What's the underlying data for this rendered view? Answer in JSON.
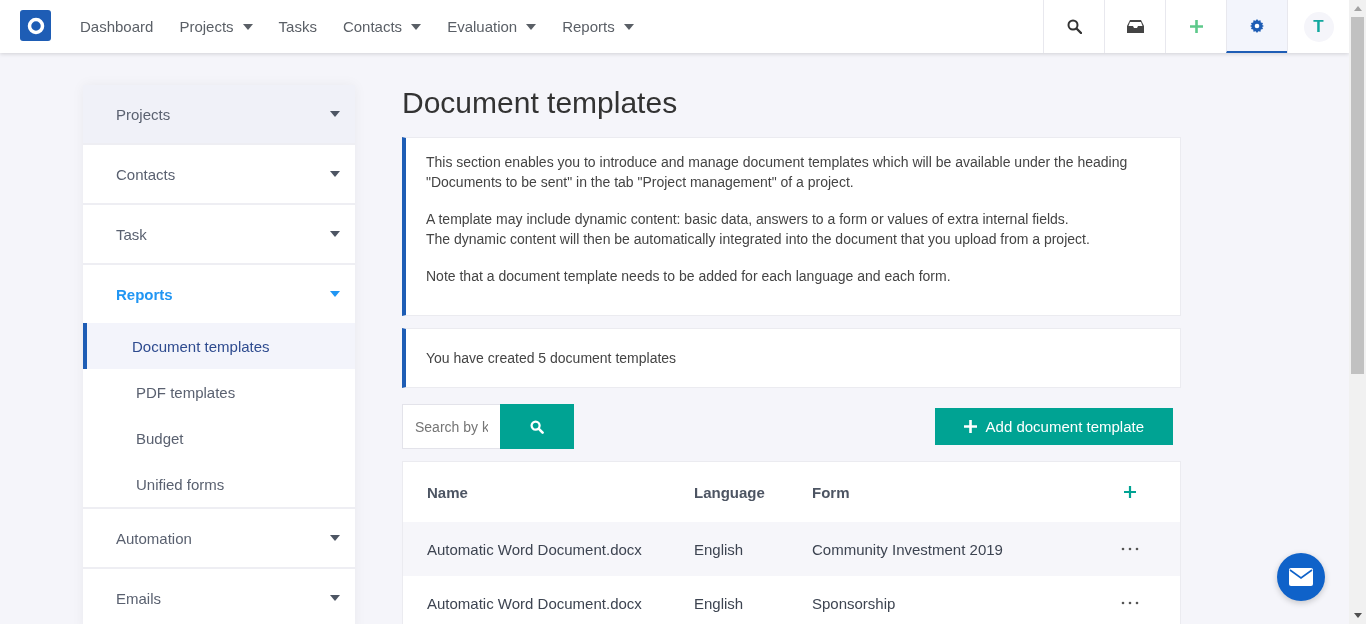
{
  "topbar": {
    "menu": [
      {
        "label": "Dashboard",
        "has_menu": false
      },
      {
        "label": "Projects",
        "has_menu": true
      },
      {
        "label": "Tasks",
        "has_menu": false
      },
      {
        "label": "Contacts",
        "has_menu": true
      },
      {
        "label": "Evaluation",
        "has_menu": true
      },
      {
        "label": "Reports",
        "has_menu": true
      }
    ],
    "tools": [
      {
        "kind": "search",
        "selected": false
      },
      {
        "kind": "inbox",
        "selected": false
      },
      {
        "kind": "add",
        "selected": false
      },
      {
        "kind": "settings",
        "selected": true
      }
    ],
    "avatar": "T"
  },
  "sidebar": {
    "groups": [
      {
        "label": "Projects",
        "active": false,
        "highlighted": true
      },
      {
        "label": "Contacts",
        "active": false,
        "highlighted": false
      },
      {
        "label": "Task",
        "active": false,
        "highlighted": false
      },
      {
        "label": "Reports",
        "active": true,
        "highlighted": false,
        "children": [
          {
            "label": "Document templates",
            "selected": true
          },
          {
            "label": "PDF templates",
            "selected": false
          },
          {
            "label": "Budget",
            "selected": false
          },
          {
            "label": "Unified forms",
            "selected": false
          }
        ]
      },
      {
        "label": "Automation",
        "active": false,
        "highlighted": false
      },
      {
        "label": "Emails",
        "active": false,
        "highlighted": false
      }
    ]
  },
  "page": {
    "title": "Document templates",
    "info": [
      {
        "lines": [
          "This section enables you to introduce and manage document templates which will be available under the heading \"Documents to be sent\" in the tab \"Project management\" of a project."
        ]
      },
      {
        "lines": [
          "A template may include dynamic content: basic data, answers to a form or values of extra internal fields.",
          "The dynamic content will then be automatically integrated into the document that you upload from a project."
        ]
      },
      {
        "lines": [
          "Note that a document template needs to be added for each language and each form."
        ]
      }
    ],
    "count": "You have created 5 document templates",
    "search": {
      "placeholder": "Search by k"
    },
    "add_button": "Add document template",
    "table": {
      "columns": [
        "Name",
        "Language",
        "Form"
      ],
      "rows": [
        {
          "name": "Automatic Word Document.docx",
          "language": "English",
          "form": "Community Investment 2019"
        },
        {
          "name": "Automatic Word Document.docx",
          "language": "English",
          "form": "Sponsorship"
        }
      ]
    }
  }
}
